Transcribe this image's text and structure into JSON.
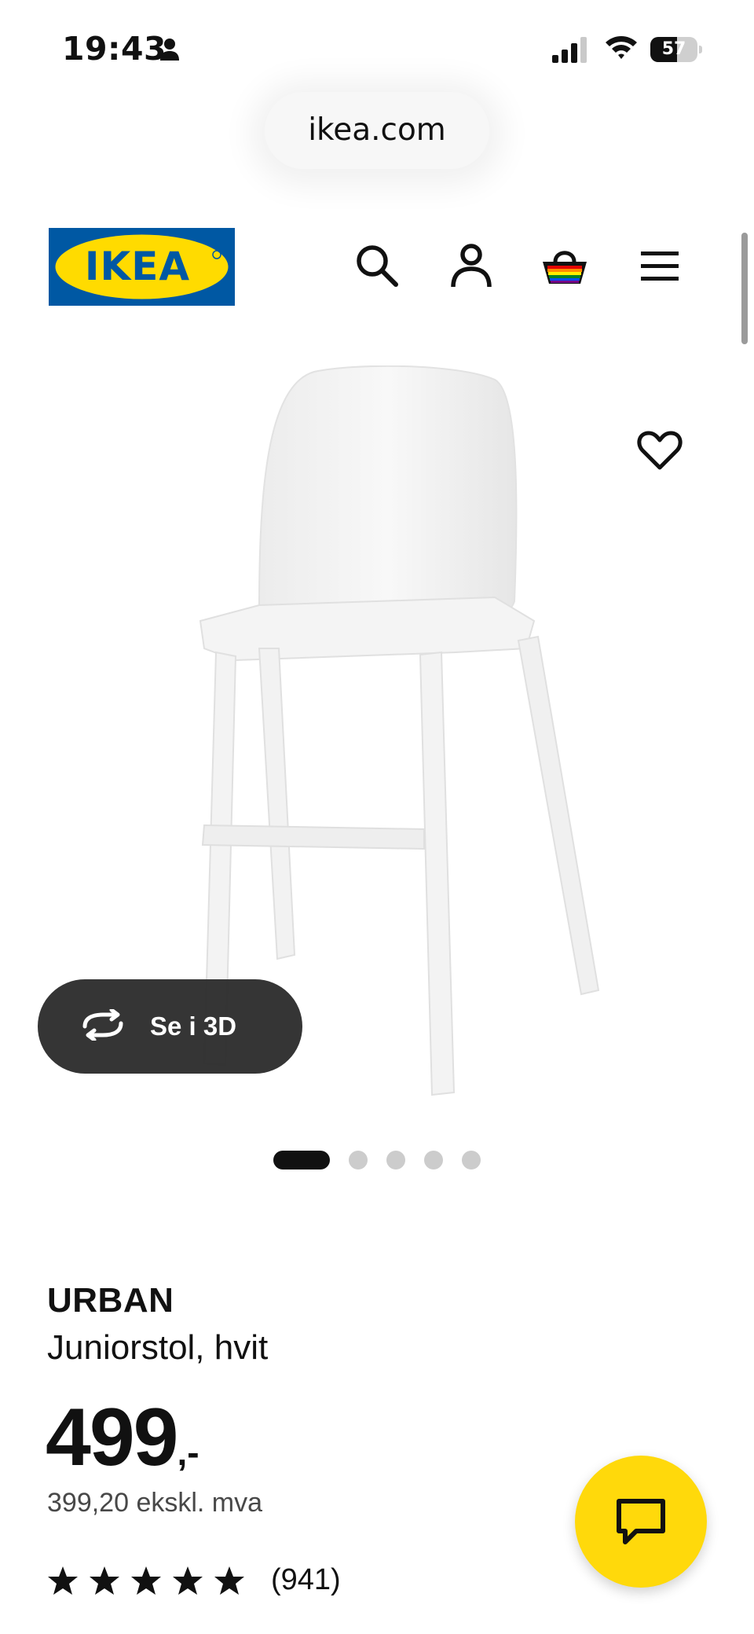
{
  "status_bar": {
    "time": "19:43",
    "battery_level": 57,
    "icons": [
      "person-icon",
      "signal-icon",
      "wifi-icon",
      "battery-icon"
    ]
  },
  "browser": {
    "url": "ikea.com"
  },
  "header": {
    "logo_text": "IKEA",
    "icons": [
      "search-icon",
      "profile-icon",
      "cart-icon",
      "menu-icon"
    ],
    "colors": {
      "logo_blue": "#0058a3",
      "logo_yellow": "#ffdb00"
    }
  },
  "gallery": {
    "view_3d_label": "Se i 3D",
    "image_count": 5,
    "active_index": 0,
    "favorite_icon": "heart-icon"
  },
  "product": {
    "name": "URBAN",
    "description": "Juniorstol, hvit",
    "price": "499",
    "price_suffix": ",-",
    "price_ex_vat": "399,20 ekskl. mva",
    "rating_stars": 5,
    "review_count": "(941)"
  },
  "chat": {
    "icon": "chat-icon",
    "color": "#ffd90b"
  }
}
